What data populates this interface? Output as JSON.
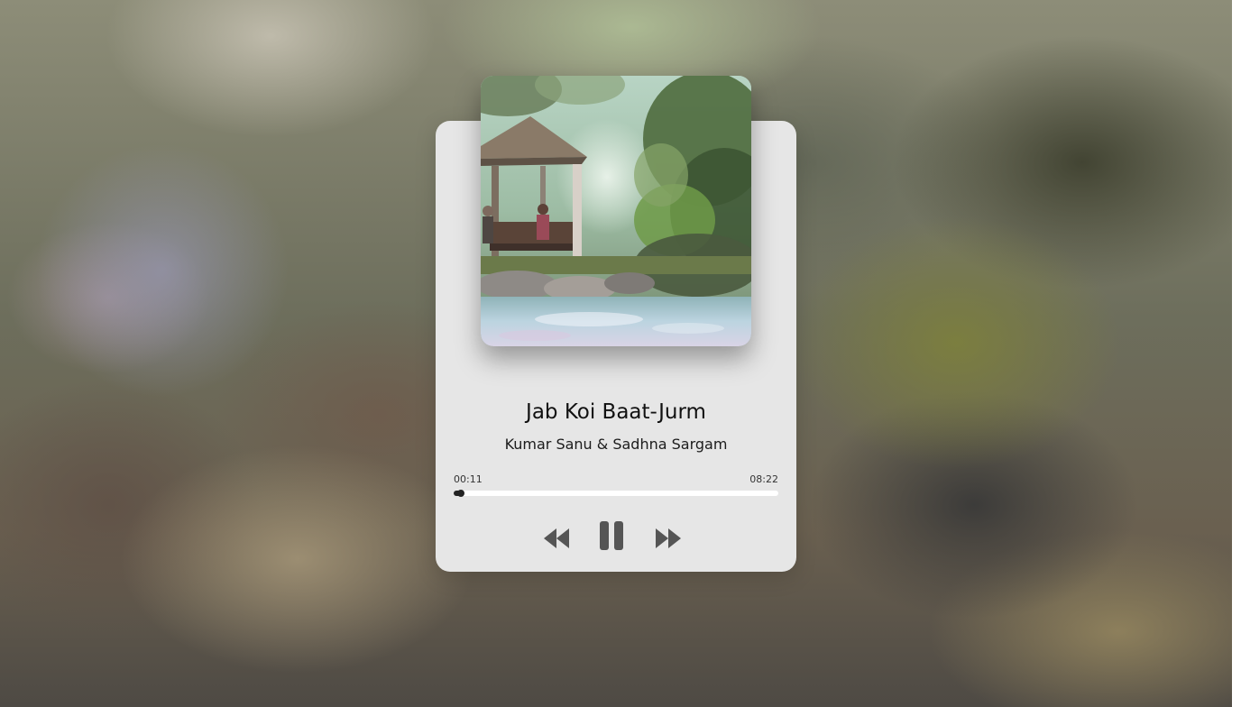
{
  "track": {
    "title": "Jab Koi Baat-Jurm",
    "artist": "Kumar Sanu & Sadhna Sargam"
  },
  "playback": {
    "current_time": "00:11",
    "total_time": "08:22",
    "progress_fraction": 0.022,
    "state": "playing"
  },
  "controls": {
    "previous_icon": "rewind-icon",
    "pause_icon": "pause-icon",
    "next_icon": "fast-forward-icon",
    "icon_color": "#555555"
  },
  "colors": {
    "card_background": "#e6e6e6",
    "track_background": "#ffffff",
    "progress_fill": "#222222",
    "title_text": "#111111"
  }
}
